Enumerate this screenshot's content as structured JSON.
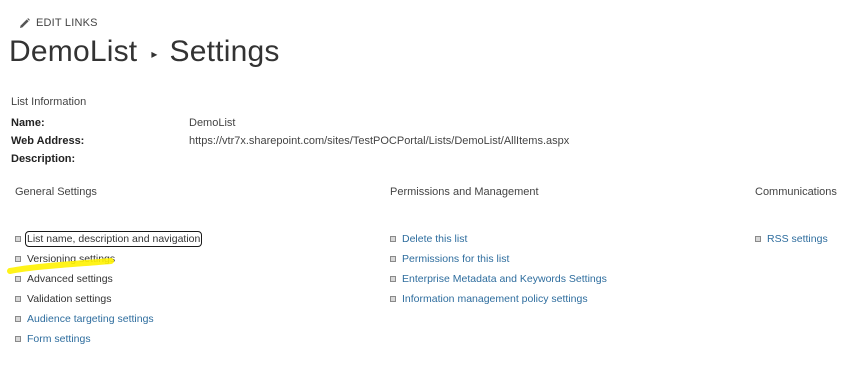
{
  "header": {
    "edit_links_label": "EDIT LINKS",
    "title_list": "DemoList",
    "title_separator": "▸",
    "title_page": "Settings"
  },
  "list_information": {
    "heading": "List Information",
    "rows": [
      {
        "key": "Name:",
        "value": "DemoList"
      },
      {
        "key": "Web Address:",
        "value": "https://vtr7x.sharepoint.com/sites/TestPOCPortal/Lists/DemoList/AllItems.aspx"
      },
      {
        "key": "Description:",
        "value": ""
      }
    ]
  },
  "general_settings": {
    "heading": "General Settings",
    "links": [
      "List name, description and navigation",
      "Versioning settings",
      "Advanced settings",
      "Validation settings",
      "Audience targeting settings",
      "Form settings"
    ]
  },
  "permissions_management": {
    "heading": "Permissions and Management",
    "links": [
      "Delete this list",
      "Permissions for this list",
      "Enterprise Metadata and Keywords Settings",
      "Information management policy settings"
    ]
  },
  "communications": {
    "heading": "Communications",
    "links": [
      "RSS settings"
    ]
  },
  "colors": {
    "link": "#2e6d9e",
    "text": "#333333",
    "highlight": "#fff200"
  }
}
